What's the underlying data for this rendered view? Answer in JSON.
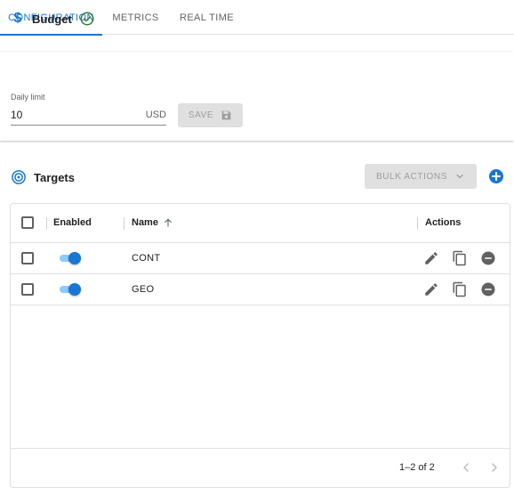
{
  "tabs": [
    {
      "label": "CONFIGURATION",
      "active": true
    },
    {
      "label": "METRICS",
      "active": false
    },
    {
      "label": "REAL TIME",
      "active": false
    }
  ],
  "budget": {
    "title": "Budget",
    "icon": "dollar-icon",
    "status_icon": "check-circle-icon",
    "field_label": "Daily limit",
    "value": "10",
    "unit": "USD",
    "save_label": "SAVE",
    "save_icon": "floppy-disk-icon"
  },
  "targets": {
    "title": "Targets",
    "icon": "target-icon",
    "bulk_label": "BULK ACTIONS",
    "add_icon": "plus-circle-icon",
    "columns": {
      "enabled": "Enabled",
      "name": "Name",
      "actions": "Actions"
    },
    "rows": [
      {
        "name": "CONT",
        "enabled": true
      },
      {
        "name": "GEO",
        "enabled": true
      }
    ],
    "pagination": "1–2 of 2"
  },
  "colors": {
    "accent": "#1976d2",
    "success": "#2e7d32",
    "disabled_bg": "#e0e0e0",
    "disabled_text": "#9e9e9e"
  }
}
